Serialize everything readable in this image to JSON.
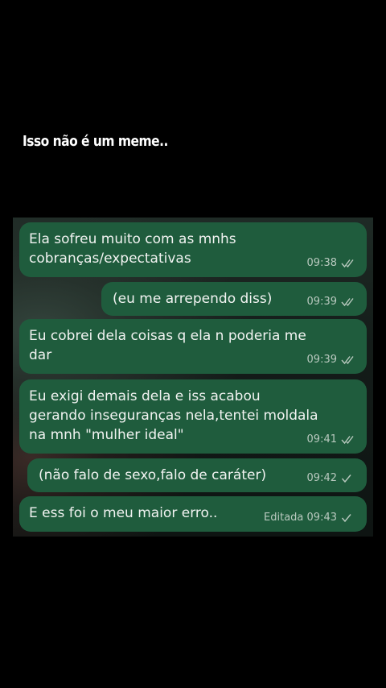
{
  "caption": "Isso não é um meme..",
  "messages": [
    {
      "text": "Ela sofreu muito com as mnhs\ncobranças/expectativas",
      "time": "09:38",
      "status_icon": "double-check-icon"
    },
    {
      "text": "(eu me arrependo diss)",
      "time": "09:39",
      "status_icon": "double-check-icon"
    },
    {
      "text": "Eu cobrei dela coisas q ela n poderia me\ndar",
      "time": "09:39",
      "status_icon": "double-check-icon"
    },
    {
      "text": "Eu exigi demais dela e iss acabou\ngerando inseguranças nela,tentei moldala\nna mnh \"mulher ideal\"",
      "time": "09:41",
      "status_icon": "double-check-icon"
    },
    {
      "text": "(não falo de sexo,falo de caráter)",
      "time": "09:42",
      "status_icon": "single-check-icon"
    },
    {
      "text": "E ess foi o meu maior erro..",
      "time": "Editada 09:43",
      "status_icon": "single-check-icon"
    }
  ],
  "colors": {
    "background": "#000000",
    "bubble": "#1f5c3d",
    "text": "#f1f3f1",
    "meta": "#b9c9bf"
  }
}
